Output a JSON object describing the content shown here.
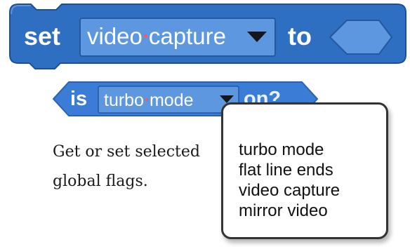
{
  "set_block": {
    "keyword": "set",
    "dropdown": {
      "word1": "video",
      "word2": "capture"
    },
    "to_keyword": "to"
  },
  "is_block": {
    "keyword": "is",
    "dropdown": {
      "word1": "turbo",
      "word2": "mode"
    },
    "tail": "on?"
  },
  "description": {
    "line1": "Get or set selected",
    "line2": "global flags."
  },
  "menu": {
    "items": [
      "turbo mode",
      "flat line ends",
      "video capture",
      "mirror video"
    ]
  },
  "colors": {
    "block_blue": "#2f6fc2",
    "block_edge": "#1d4f97",
    "slot_blue": "#5c97df",
    "separator_dot": "#ff5a5a",
    "menu_border": "#333333"
  },
  "icons": {
    "dropdown_arrow": "triangle-down"
  }
}
